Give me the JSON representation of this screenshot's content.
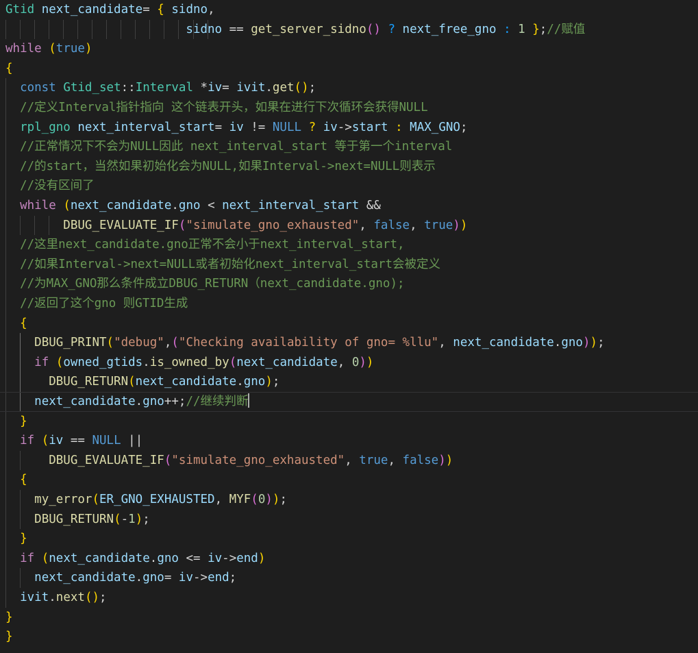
{
  "editor": {
    "language": "cpp",
    "theme": "dark-plus",
    "background_color": "#1e1e1e",
    "foreground_color": "#d4d4d4",
    "current_line_index": 20,
    "cursor": {
      "line": 20,
      "column": 38
    },
    "colors": {
      "comment": "#6a9955",
      "keyword_control": "#c586c0",
      "keyword": "#569cd6",
      "type": "#4ec9b0",
      "variable": "#9cdcfe",
      "function": "#dcdcaa",
      "string": "#ce9178",
      "number": "#b5cea8",
      "punctuation": "#d4d4d4",
      "bracket_yellow": "#ffd700",
      "bracket_pink": "#da70d6",
      "bracket_blue": "#179fff",
      "indent_guide": "#404040",
      "indent_guide_active": "#707070",
      "current_line_border": "#333335",
      "caret": "#aeafad"
    }
  },
  "lines": [
    {
      "index": 0,
      "indent_guides": [],
      "tokens": [
        {
          "t": "Gtid",
          "c": "typ"
        },
        {
          "t": " ",
          "c": "pn"
        },
        {
          "t": "next_candidate",
          "c": "var"
        },
        {
          "t": "= ",
          "c": "pn"
        },
        {
          "t": "{",
          "c": "br0"
        },
        {
          "t": " ",
          "c": "pn"
        },
        {
          "t": "sidno",
          "c": "var"
        },
        {
          "t": ",",
          "c": "pn"
        }
      ]
    },
    {
      "index": 1,
      "indent_guides": [
        0,
        1,
        2,
        3,
        4,
        5,
        6,
        7,
        8,
        9,
        10,
        11,
        12,
        13,
        14
      ],
      "tokens": [
        {
          "t": "                         ",
          "c": "pn"
        },
        {
          "t": "sidno",
          "c": "var"
        },
        {
          "t": " == ",
          "c": "pn"
        },
        {
          "t": "get_server_sidno",
          "c": "fn"
        },
        {
          "t": "()",
          "c": "br1"
        },
        {
          "t": " ",
          "c": "pn"
        },
        {
          "t": "?",
          "c": "br2"
        },
        {
          "t": " ",
          "c": "pn"
        },
        {
          "t": "next_free_gno",
          "c": "var"
        },
        {
          "t": " ",
          "c": "pn"
        },
        {
          "t": ":",
          "c": "br2"
        },
        {
          "t": " ",
          "c": "pn"
        },
        {
          "t": "1",
          "c": "num"
        },
        {
          "t": " ",
          "c": "pn"
        },
        {
          "t": "}",
          "c": "br0"
        },
        {
          "t": ";",
          "c": "pn"
        },
        {
          "t": "//赋值",
          "c": "cmt"
        }
      ]
    },
    {
      "index": 2,
      "indent_guides": [],
      "tokens": [
        {
          "t": "while",
          "c": "kw"
        },
        {
          "t": " ",
          "c": "pn"
        },
        {
          "t": "(",
          "c": "br0"
        },
        {
          "t": "true",
          "c": "kw2"
        },
        {
          "t": ")",
          "c": "br0"
        }
      ]
    },
    {
      "index": 3,
      "indent_guides": [],
      "tokens": [
        {
          "t": "{",
          "c": "br0"
        }
      ]
    },
    {
      "index": 4,
      "indent_guides": [
        0
      ],
      "tokens": [
        {
          "t": "  ",
          "c": "pn"
        },
        {
          "t": "const",
          "c": "kw2"
        },
        {
          "t": " ",
          "c": "pn"
        },
        {
          "t": "Gtid_set",
          "c": "typ"
        },
        {
          "t": "::",
          "c": "pn"
        },
        {
          "t": "Interval",
          "c": "typ"
        },
        {
          "t": " *",
          "c": "pn"
        },
        {
          "t": "iv",
          "c": "var"
        },
        {
          "t": "= ",
          "c": "pn"
        },
        {
          "t": "ivit",
          "c": "var"
        },
        {
          "t": ".",
          "c": "pn"
        },
        {
          "t": "get",
          "c": "fn"
        },
        {
          "t": "()",
          "c": "br0"
        },
        {
          "t": ";",
          "c": "pn"
        }
      ]
    },
    {
      "index": 5,
      "indent_guides": [
        0
      ],
      "tokens": [
        {
          "t": "  ",
          "c": "pn"
        },
        {
          "t": "//定义Interval指针指向 这个链表开头，如果在进行下次循环会获得NULL",
          "c": "cmt"
        }
      ]
    },
    {
      "index": 6,
      "indent_guides": [
        0
      ],
      "tokens": [
        {
          "t": "  ",
          "c": "pn"
        },
        {
          "t": "rpl_gno",
          "c": "typ"
        },
        {
          "t": " ",
          "c": "pn"
        },
        {
          "t": "next_interval_start",
          "c": "var"
        },
        {
          "t": "= ",
          "c": "pn"
        },
        {
          "t": "iv",
          "c": "var"
        },
        {
          "t": " != ",
          "c": "pn"
        },
        {
          "t": "NULL",
          "c": "kw2"
        },
        {
          "t": " ",
          "c": "pn"
        },
        {
          "t": "?",
          "c": "br0"
        },
        {
          "t": " ",
          "c": "pn"
        },
        {
          "t": "iv",
          "c": "var"
        },
        {
          "t": "->",
          "c": "pn"
        },
        {
          "t": "start",
          "c": "var"
        },
        {
          "t": " ",
          "c": "pn"
        },
        {
          "t": ":",
          "c": "br0"
        },
        {
          "t": " ",
          "c": "pn"
        },
        {
          "t": "MAX_GNO",
          "c": "var"
        },
        {
          "t": ";",
          "c": "pn"
        }
      ]
    },
    {
      "index": 7,
      "indent_guides": [
        0
      ],
      "tokens": [
        {
          "t": "  ",
          "c": "pn"
        },
        {
          "t": "//正常情况下不会为NULL因此 next_interval_start 等于第一个interval",
          "c": "cmt"
        }
      ]
    },
    {
      "index": 8,
      "indent_guides": [
        0
      ],
      "tokens": [
        {
          "t": "  ",
          "c": "pn"
        },
        {
          "t": "//的start，当然如果初始化会为NULL,如果Interval->next=NULL则表示",
          "c": "cmt"
        }
      ]
    },
    {
      "index": 9,
      "indent_guides": [
        0
      ],
      "tokens": [
        {
          "t": "  ",
          "c": "pn"
        },
        {
          "t": "//没有区间了",
          "c": "cmt"
        }
      ]
    },
    {
      "index": 10,
      "indent_guides": [
        0
      ],
      "tokens": [
        {
          "t": "  ",
          "c": "pn"
        },
        {
          "t": "while",
          "c": "kw"
        },
        {
          "t": " ",
          "c": "pn"
        },
        {
          "t": "(",
          "c": "br0"
        },
        {
          "t": "next_candidate",
          "c": "var"
        },
        {
          "t": ".",
          "c": "pn"
        },
        {
          "t": "gno",
          "c": "var"
        },
        {
          "t": " < ",
          "c": "pn"
        },
        {
          "t": "next_interval_start",
          "c": "var"
        },
        {
          "t": " &&",
          "c": "pn"
        }
      ]
    },
    {
      "index": 11,
      "indent_guides": [
        0,
        1,
        2,
        3
      ],
      "tokens": [
        {
          "t": "        ",
          "c": "pn"
        },
        {
          "t": "DBUG_EVALUATE_IF",
          "c": "fn"
        },
        {
          "t": "(",
          "c": "br1"
        },
        {
          "t": "\"simulate_gno_exhausted\"",
          "c": "str"
        },
        {
          "t": ", ",
          "c": "pn"
        },
        {
          "t": "false",
          "c": "kw2"
        },
        {
          "t": ", ",
          "c": "pn"
        },
        {
          "t": "true",
          "c": "kw2"
        },
        {
          "t": ")",
          "c": "br1"
        },
        {
          "t": ")",
          "c": "br0"
        }
      ]
    },
    {
      "index": 12,
      "indent_guides": [
        0
      ],
      "tokens": [
        {
          "t": "  ",
          "c": "pn"
        },
        {
          "t": "//这里next_candidate.gno正常不会小于next_interval_start,",
          "c": "cmt"
        }
      ]
    },
    {
      "index": 13,
      "indent_guides": [
        0
      ],
      "tokens": [
        {
          "t": "  ",
          "c": "pn"
        },
        {
          "t": "//如果Interval->next=NULL或者初始化next_interval_start会被定义",
          "c": "cmt"
        }
      ]
    },
    {
      "index": 14,
      "indent_guides": [
        0
      ],
      "tokens": [
        {
          "t": "  ",
          "c": "pn"
        },
        {
          "t": "//为MAX_GNO那么条件成立DBUG_RETURN（next_candidate.gno);",
          "c": "cmt"
        }
      ]
    },
    {
      "index": 15,
      "indent_guides": [
        0
      ],
      "tokens": [
        {
          "t": "  ",
          "c": "pn"
        },
        {
          "t": "//返回了这个gno 则GTID生成",
          "c": "cmt"
        }
      ]
    },
    {
      "index": 16,
      "indent_guides": [
        0
      ],
      "tokens": [
        {
          "t": "  ",
          "c": "pn"
        },
        {
          "t": "{",
          "c": "br0"
        }
      ]
    },
    {
      "index": 17,
      "indent_guides": [
        0,
        1
      ],
      "tokens": [
        {
          "t": "    ",
          "c": "pn"
        },
        {
          "t": "DBUG_PRINT",
          "c": "fn"
        },
        {
          "t": "(",
          "c": "br0"
        },
        {
          "t": "\"debug\"",
          "c": "str"
        },
        {
          "t": ",",
          "c": "pn"
        },
        {
          "t": "(",
          "c": "br1"
        },
        {
          "t": "\"Checking availability of gno= %llu\"",
          "c": "str"
        },
        {
          "t": ", ",
          "c": "pn"
        },
        {
          "t": "next_candidate",
          "c": "var"
        },
        {
          "t": ".",
          "c": "pn"
        },
        {
          "t": "gno",
          "c": "var"
        },
        {
          "t": ")",
          "c": "br1"
        },
        {
          "t": ")",
          "c": "br0"
        },
        {
          "t": ";",
          "c": "pn"
        }
      ]
    },
    {
      "index": 18,
      "indent_guides": [
        0,
        1
      ],
      "tokens": [
        {
          "t": "    ",
          "c": "pn"
        },
        {
          "t": "if",
          "c": "kw"
        },
        {
          "t": " ",
          "c": "pn"
        },
        {
          "t": "(",
          "c": "br0"
        },
        {
          "t": "owned_gtids",
          "c": "var"
        },
        {
          "t": ".",
          "c": "pn"
        },
        {
          "t": "is_owned_by",
          "c": "fn"
        },
        {
          "t": "(",
          "c": "br1"
        },
        {
          "t": "next_candidate",
          "c": "var"
        },
        {
          "t": ", ",
          "c": "pn"
        },
        {
          "t": "0",
          "c": "num"
        },
        {
          "t": ")",
          "c": "br1"
        },
        {
          "t": ")",
          "c": "br0"
        }
      ]
    },
    {
      "index": 19,
      "indent_guides": [
        0,
        1
      ],
      "tokens": [
        {
          "t": "      ",
          "c": "pn"
        },
        {
          "t": "DBUG_RETURN",
          "c": "fn"
        },
        {
          "t": "(",
          "c": "br0"
        },
        {
          "t": "next_candidate",
          "c": "var"
        },
        {
          "t": ".",
          "c": "pn"
        },
        {
          "t": "gno",
          "c": "var"
        },
        {
          "t": ")",
          "c": "br0"
        },
        {
          "t": ";",
          "c": "pn"
        }
      ]
    },
    {
      "index": 20,
      "active": true,
      "cursor_after": true,
      "indent_guides": [
        0,
        1
      ],
      "tokens": [
        {
          "t": "    ",
          "c": "pn"
        },
        {
          "t": "next_candidate",
          "c": "var"
        },
        {
          "t": ".",
          "c": "pn"
        },
        {
          "t": "gno",
          "c": "var"
        },
        {
          "t": "++;",
          "c": "pn"
        },
        {
          "t": "//继续判断",
          "c": "cmt"
        }
      ]
    },
    {
      "index": 21,
      "indent_guides": [
        0
      ],
      "tokens": [
        {
          "t": "  ",
          "c": "pn"
        },
        {
          "t": "}",
          "c": "br0"
        }
      ]
    },
    {
      "index": 22,
      "indent_guides": [
        0
      ],
      "tokens": [
        {
          "t": "  ",
          "c": "pn"
        },
        {
          "t": "if",
          "c": "kw"
        },
        {
          "t": " ",
          "c": "pn"
        },
        {
          "t": "(",
          "c": "br0"
        },
        {
          "t": "iv",
          "c": "var"
        },
        {
          "t": " == ",
          "c": "pn"
        },
        {
          "t": "NULL",
          "c": "kw2"
        },
        {
          "t": " ||",
          "c": "pn"
        }
      ]
    },
    {
      "index": 23,
      "indent_guides": [
        0,
        1
      ],
      "tokens": [
        {
          "t": "      ",
          "c": "pn"
        },
        {
          "t": "DBUG_EVALUATE_IF",
          "c": "fn"
        },
        {
          "t": "(",
          "c": "br1"
        },
        {
          "t": "\"simulate_gno_exhausted\"",
          "c": "str"
        },
        {
          "t": ", ",
          "c": "pn"
        },
        {
          "t": "true",
          "c": "kw2"
        },
        {
          "t": ", ",
          "c": "pn"
        },
        {
          "t": "false",
          "c": "kw2"
        },
        {
          "t": ")",
          "c": "br1"
        },
        {
          "t": ")",
          "c": "br0"
        }
      ]
    },
    {
      "index": 24,
      "indent_guides": [
        0
      ],
      "tokens": [
        {
          "t": "  ",
          "c": "pn"
        },
        {
          "t": "{",
          "c": "br0"
        }
      ]
    },
    {
      "index": 25,
      "indent_guides": [
        0,
        1
      ],
      "tokens": [
        {
          "t": "    ",
          "c": "pn"
        },
        {
          "t": "my_error",
          "c": "fn"
        },
        {
          "t": "(",
          "c": "br0"
        },
        {
          "t": "ER_GNO_EXHAUSTED",
          "c": "var"
        },
        {
          "t": ", ",
          "c": "pn"
        },
        {
          "t": "MYF",
          "c": "fn"
        },
        {
          "t": "(",
          "c": "br1"
        },
        {
          "t": "0",
          "c": "num"
        },
        {
          "t": ")",
          "c": "br1"
        },
        {
          "t": ")",
          "c": "br0"
        },
        {
          "t": ";",
          "c": "pn"
        }
      ]
    },
    {
      "index": 26,
      "indent_guides": [
        0,
        1
      ],
      "tokens": [
        {
          "t": "    ",
          "c": "pn"
        },
        {
          "t": "DBUG_RETURN",
          "c": "fn"
        },
        {
          "t": "(",
          "c": "br0"
        },
        {
          "t": "-",
          "c": "pn"
        },
        {
          "t": "1",
          "c": "num"
        },
        {
          "t": ")",
          "c": "br0"
        },
        {
          "t": ";",
          "c": "pn"
        }
      ]
    },
    {
      "index": 27,
      "indent_guides": [
        0
      ],
      "tokens": [
        {
          "t": "  ",
          "c": "pn"
        },
        {
          "t": "}",
          "c": "br0"
        }
      ]
    },
    {
      "index": 28,
      "indent_guides": [
        0
      ],
      "tokens": [
        {
          "t": "  ",
          "c": "pn"
        },
        {
          "t": "if",
          "c": "kw"
        },
        {
          "t": " ",
          "c": "pn"
        },
        {
          "t": "(",
          "c": "br0"
        },
        {
          "t": "next_candidate",
          "c": "var"
        },
        {
          "t": ".",
          "c": "pn"
        },
        {
          "t": "gno",
          "c": "var"
        },
        {
          "t": " <= ",
          "c": "pn"
        },
        {
          "t": "iv",
          "c": "var"
        },
        {
          "t": "->",
          "c": "pn"
        },
        {
          "t": "end",
          "c": "var"
        },
        {
          "t": ")",
          "c": "br0"
        }
      ]
    },
    {
      "index": 29,
      "indent_guides": [
        0,
        1
      ],
      "tokens": [
        {
          "t": "    ",
          "c": "pn"
        },
        {
          "t": "next_candidate",
          "c": "var"
        },
        {
          "t": ".",
          "c": "pn"
        },
        {
          "t": "gno",
          "c": "var"
        },
        {
          "t": "= ",
          "c": "pn"
        },
        {
          "t": "iv",
          "c": "var"
        },
        {
          "t": "->",
          "c": "pn"
        },
        {
          "t": "end",
          "c": "var"
        },
        {
          "t": ";",
          "c": "pn"
        }
      ]
    },
    {
      "index": 30,
      "indent_guides": [
        0
      ],
      "tokens": [
        {
          "t": "  ",
          "c": "pn"
        },
        {
          "t": "ivit",
          "c": "var"
        },
        {
          "t": ".",
          "c": "pn"
        },
        {
          "t": "next",
          "c": "fn"
        },
        {
          "t": "()",
          "c": "br0"
        },
        {
          "t": ";",
          "c": "pn"
        }
      ]
    },
    {
      "index": 31,
      "indent_guides": [],
      "tokens": [
        {
          "t": "}",
          "c": "br0"
        }
      ]
    },
    {
      "index": 32,
      "indent_guides": [],
      "tokens": [
        {
          "t": "}",
          "c": "br0"
        }
      ]
    }
  ]
}
